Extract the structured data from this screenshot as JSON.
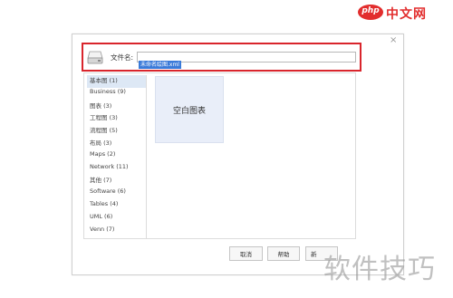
{
  "watermark": {
    "logo_badge": "php",
    "logo_text": "中文网",
    "text": "软件技巧",
    "brand_color": "#e22d2d"
  },
  "dialog": {
    "close_symbol": "×",
    "filename_label": "文件名:",
    "filename_value": "未命名绘图.xml",
    "highlight_color": "#d9252c",
    "categories": [
      {
        "label": "基本图 (1)",
        "selected": true
      },
      {
        "label": "Business (9)"
      },
      {
        "label": "图表 (3)"
      },
      {
        "label": "工程图 (3)"
      },
      {
        "label": "流程图 (5)"
      },
      {
        "label": "布局 (3)"
      },
      {
        "label": "Maps (2)"
      },
      {
        "label": "Network (11)"
      },
      {
        "label": "其他 (7)"
      },
      {
        "label": "Software (6)"
      },
      {
        "label": "Tables (4)"
      },
      {
        "label": "UML (6)"
      },
      {
        "label": "Venn (7)"
      }
    ],
    "template_label": "空白图表",
    "buttons": {
      "cancel": "取消",
      "help": "帮助",
      "open": "新"
    }
  },
  "icons": {
    "drive": "drive-icon",
    "close": "close-icon"
  }
}
